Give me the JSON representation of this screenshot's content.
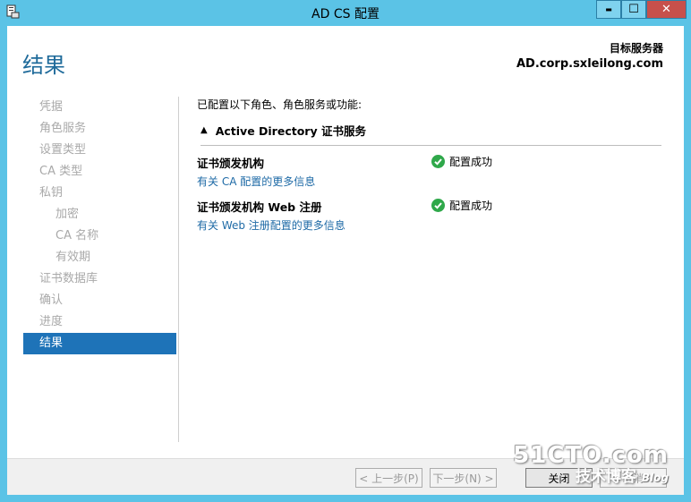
{
  "window": {
    "title": "AD CS 配置",
    "controls": {
      "minimize": "▬",
      "maximize": "☐",
      "close": "✕"
    }
  },
  "header": {
    "page_title": "结果",
    "destination_label": "目标服务器",
    "destination_server": "AD.corp.sxleilong.com"
  },
  "nav": {
    "items": [
      {
        "label": "凭据"
      },
      {
        "label": "角色服务"
      },
      {
        "label": "设置类型"
      },
      {
        "label": "CA 类型"
      },
      {
        "label": "私钥"
      },
      {
        "label": "加密"
      },
      {
        "label": "CA 名称"
      },
      {
        "label": "有效期"
      },
      {
        "label": "证书数据库"
      },
      {
        "label": "确认"
      },
      {
        "label": "进度"
      },
      {
        "label": "结果"
      }
    ]
  },
  "content": {
    "intro": "已配置以下角色、角色服务或功能:",
    "section_title": "Active Directory 证书服务",
    "rows": [
      {
        "name": "证书颁发机构",
        "link": "有关 CA 配置的更多信息",
        "status": "配置成功"
      },
      {
        "name": "证书颁发机构 Web 注册",
        "link": "有关 Web 注册配置的更多信息",
        "status": "配置成功"
      }
    ]
  },
  "footer": {
    "prev": "< 上一步(P)",
    "next": "下一步(N) >",
    "close": "关闭",
    "cancel": "取消"
  },
  "watermark": {
    "main": "51CTO.com",
    "sub": "技术博客",
    "blog": "Blog"
  },
  "colors": {
    "titlebar": "#5bc3e6",
    "accent_blue": "#1e73b8",
    "link": "#1e6aa6",
    "success": "#2fa84a",
    "close_button": "#c7504b"
  }
}
